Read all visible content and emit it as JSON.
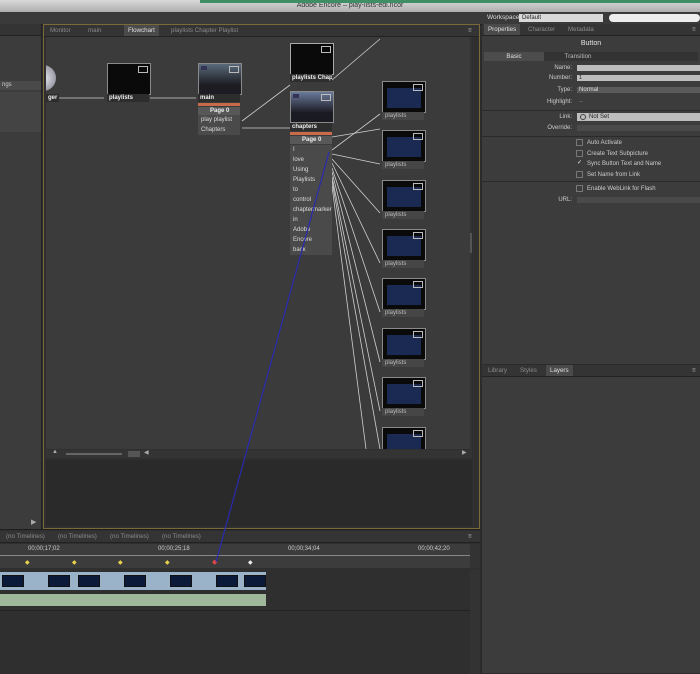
{
  "window": {
    "title": "Adobe Encore – play-lists-edl.ncor"
  },
  "workspace": {
    "label": "Workspace:",
    "value": "Default"
  },
  "left": {
    "partial_label": "ngs"
  },
  "center": {
    "tabs": [
      "Monitor",
      "main",
      "Flowchart",
      "playlists Chapter Playlist"
    ],
    "nodes": {
      "ger": "ger",
      "playlists": "playlists",
      "main": "main",
      "main_page": "Page 0",
      "main_rows": [
        "play playlist",
        "Chapters"
      ],
      "playlists_chap": "playlists Chap",
      "chapters": "chapters",
      "chapters_page": "Page 0",
      "chapters_rows": [
        "I",
        "love",
        "Using",
        "Playlists",
        "to",
        "control",
        "chaptermarker",
        "in",
        "Adobe",
        "Encore",
        "back"
      ],
      "right_label": "playlists"
    }
  },
  "timeline": {
    "tabs": [
      "(no Timelines)",
      "(no Timelines)",
      "(no Timelines)",
      "(no Timelines)"
    ],
    "timecodes": [
      "00;00;17;02",
      "00;00;25;18",
      "00;00;34;04",
      "00;00;42;20"
    ]
  },
  "properties": {
    "tabs": [
      "Properties",
      "Character",
      "Metadata"
    ],
    "heading": "Button",
    "subtabs": [
      "Basic",
      "Transition"
    ],
    "fields": {
      "name_label": "Name:",
      "number_label": "Number:",
      "number_value": "1",
      "type_label": "Type:",
      "type_value": "Normal",
      "highlight_label": "Highlight:",
      "highlight_value": "--",
      "link_label": "Link:",
      "link_value": "Not Set",
      "override_label": "Override:"
    },
    "checks": [
      {
        "label": "Auto Activate",
        "checked": false
      },
      {
        "label": "Create Text Subpicture",
        "checked": false
      },
      {
        "label": "Sync Button Text and Name",
        "checked": true
      },
      {
        "label": "Set Name from Link",
        "checked": false
      },
      {
        "label": "Enable WebLink for Flash",
        "checked": false
      }
    ],
    "url_label": "URL:"
  },
  "layers": {
    "tabs": [
      "Library",
      "Styles",
      "Layers"
    ]
  }
}
